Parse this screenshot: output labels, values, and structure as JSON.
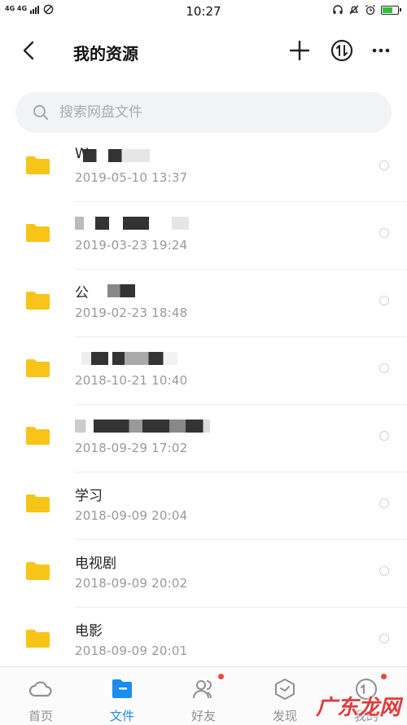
{
  "status_bar": {
    "network": "4G 4G",
    "time": "10:27",
    "battery_level": 0.7,
    "battery_color": "#32c132"
  },
  "header": {
    "title": "我的资源",
    "back_icon": "chevron-left-icon",
    "add_icon": "plus-icon",
    "transfer_icon": "transfer-icon",
    "more_icon": "more-icon"
  },
  "search": {
    "placeholder": "搜索网盘文件",
    "value": ""
  },
  "files": [
    {
      "name": "W",
      "date": "2019-05-10  13:37"
    },
    {
      "name": "",
      "date": "2019-03-23  19:24"
    },
    {
      "name": "公",
      "date": "2019-02-23  18:48"
    },
    {
      "name": "",
      "date": "2018-10-21  10:40"
    },
    {
      "name": "",
      "date": "2018-09-29  17:02"
    },
    {
      "name": "学习",
      "date": "2018-09-09  20:04"
    },
    {
      "name": "电视剧",
      "date": "2018-09-09  20:02"
    },
    {
      "name": "电影",
      "date": "2018-09-09  20:01"
    }
  ],
  "tabs": [
    {
      "label": "首页",
      "icon": "cloud-icon"
    },
    {
      "label": "文件",
      "icon": "file-icon"
    },
    {
      "label": "好友",
      "icon": "friends-icon"
    },
    {
      "label": "发现",
      "icon": "discover-icon"
    },
    {
      "label": "我的",
      "icon": "profile-icon"
    }
  ],
  "watermark": "广东龙网",
  "colors": {
    "accent": "#1b8cf0",
    "folder": "#f7c417",
    "badge": "#e84c3d"
  }
}
